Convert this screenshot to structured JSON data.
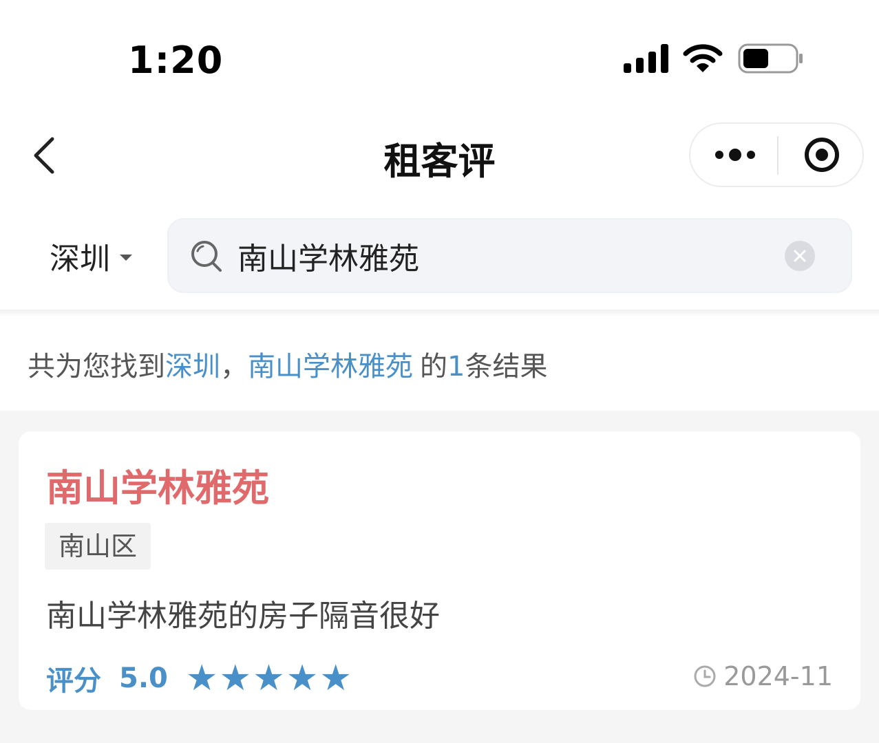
{
  "status_bar": {
    "time": "1:20"
  },
  "nav": {
    "title": "租客评"
  },
  "filter": {
    "city": "深圳"
  },
  "search": {
    "value": "南山学林雅苑"
  },
  "summary": {
    "prefix": "共为您找到",
    "city": "深圳",
    "comma": "，",
    "keyword": "南山学林雅苑",
    "middle": "的",
    "count": "1",
    "suffix": "条结果"
  },
  "results": [
    {
      "title": "南山学林雅苑",
      "district": "南山区",
      "review": "南山学林雅苑的房子隔音很好",
      "rating_label": "评分",
      "rating_value": "5.0",
      "stars": "★★★★★",
      "date": "2024-11"
    }
  ],
  "colors": {
    "accent": "#4a90c8",
    "title": "#e0696b"
  }
}
